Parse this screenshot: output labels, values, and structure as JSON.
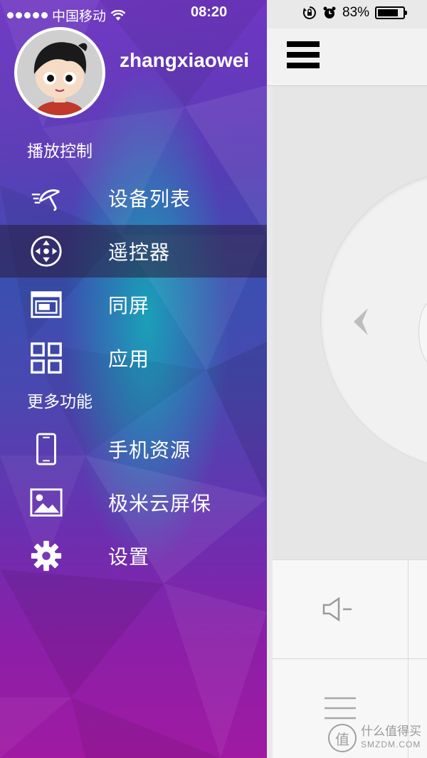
{
  "status_bar": {
    "carrier": "中国移动",
    "time": "08:20",
    "battery_text": "83%",
    "battery_level": 0.83
  },
  "drawer": {
    "username": "zhangxiaowei",
    "sections": {
      "playback": "播放控制",
      "more": "更多功能"
    },
    "items": [
      {
        "label": "设备列表",
        "icon": "umbrella-signal-icon"
      },
      {
        "label": "遥控器",
        "icon": "dpad-icon",
        "active": true
      },
      {
        "label": "同屏",
        "icon": "screen-mirror-icon"
      },
      {
        "label": "应用",
        "icon": "apps-grid-icon"
      },
      {
        "label": "手机资源",
        "icon": "phone-icon"
      },
      {
        "label": "极米云屏保",
        "icon": "image-icon"
      },
      {
        "label": "设置",
        "icon": "gear-icon"
      }
    ]
  },
  "watermark": {
    "glyph": "值",
    "cn": "什么值得买",
    "en": "SMZDM.COM"
  },
  "colors": {
    "drawer_top": "#6a2fc0",
    "drawer_mid": "#1aa0b8",
    "drawer_bottom": "#a01aa2",
    "active_row": "#2a2040"
  }
}
